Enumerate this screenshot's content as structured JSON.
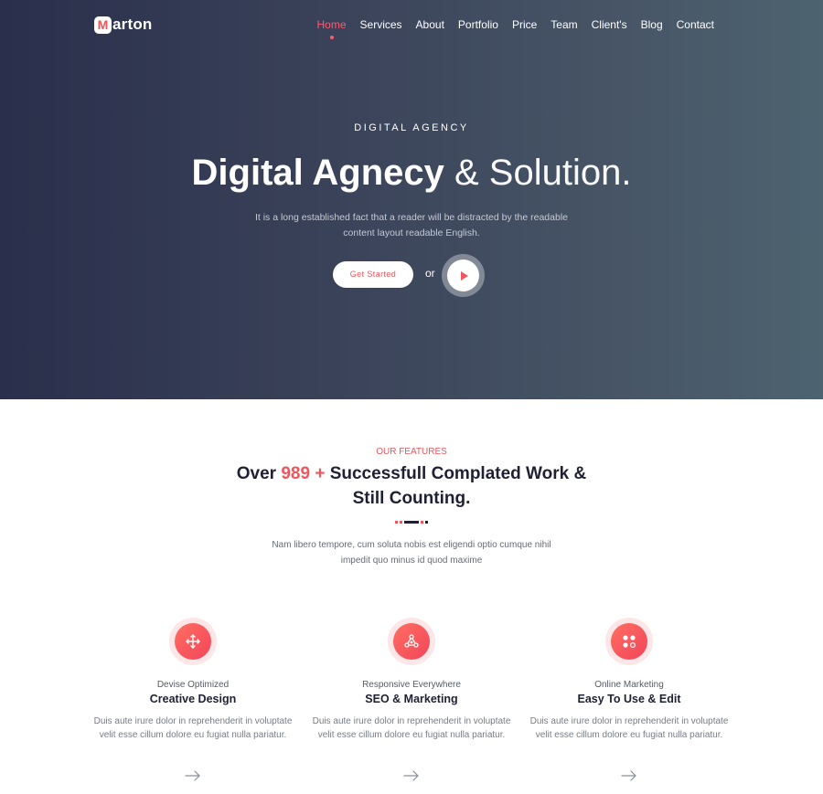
{
  "brand": {
    "logo_letter": "M",
    "logo_rest": "arton"
  },
  "nav": {
    "items": [
      {
        "label": "Home",
        "active": true
      },
      {
        "label": "Services"
      },
      {
        "label": "About"
      },
      {
        "label": "Portfolio"
      },
      {
        "label": "Price"
      },
      {
        "label": "Team"
      },
      {
        "label": "Client's"
      },
      {
        "label": "Blog"
      },
      {
        "label": "Contact"
      }
    ]
  },
  "hero": {
    "eyebrow": "DIGITAL AGENCY",
    "title_bold": "Digital Agnecy",
    "title_light": "& Solution.",
    "text": "It is a long established fact that a reader will be distracted by the readable content layout readable English.",
    "cta_label": "Get Started",
    "or_label": "or",
    "play_icon": "play-icon"
  },
  "features": {
    "eyebrow": "OUR FEATURES",
    "title_pre": "Over ",
    "title_accent": "989 +",
    "title_post": " Successfull Complated Work & Still Counting.",
    "text": "Nam libero tempore, cum soluta nobis est eligendi optio cumque nihil impedit quo minus id quod maxime",
    "cards": [
      {
        "icon": "move-arrows-icon",
        "subtitle": "Devise Optimized",
        "title": "Creative Design",
        "text": "Duis aute irure dolor in reprehenderit in voluptate velit esse cillum dolore eu fugiat nulla pariatur."
      },
      {
        "icon": "network-nodes-icon",
        "subtitle": "Responsive Everywhere",
        "title": "SEO & Marketing",
        "text": "Duis aute irure dolor in reprehenderit in voluptate velit esse cillum dolore eu fugiat nulla pariatur."
      },
      {
        "icon": "apps-grid-icon",
        "subtitle": "Online Marketing",
        "title": "Easy To Use & Edit",
        "text": "Duis aute irure dolor in reprehenderit in voluptate velit esse cillum dolore eu fugiat nulla pariatur."
      }
    ]
  },
  "colors": {
    "accent": "#f2545b",
    "nav_active": "#ff5a6e",
    "hero_gradient_start": "#2a2f4b",
    "hero_gradient_end": "#4d6370",
    "heading": "#1f2033"
  }
}
